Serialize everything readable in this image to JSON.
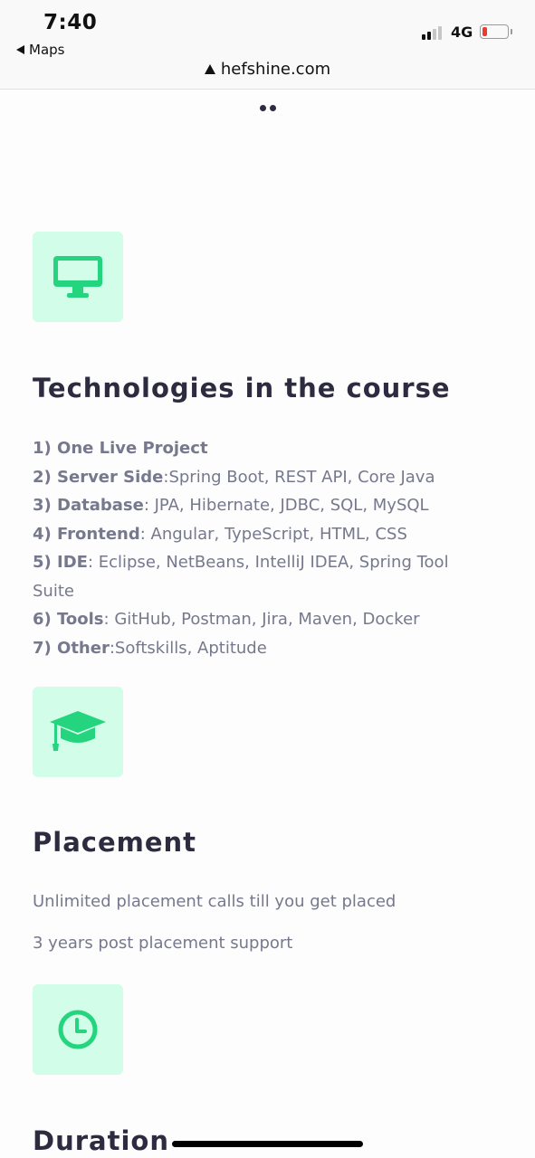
{
  "status_bar": {
    "time": "7:40",
    "back_app": "Maps",
    "network": "4G",
    "url": "hefshine.com"
  },
  "sections": {
    "technologies": {
      "title": "Technologies in the course",
      "icon": "monitor-icon",
      "items": [
        {
          "label": "1) One Live Project",
          "value": ""
        },
        {
          "label": "2) Server Side",
          "value": ":Spring Boot, REST API, Core Java"
        },
        {
          "label": "3) Database",
          "value": ": JPA, Hibernate, JDBC, SQL, MySQL"
        },
        {
          "label": "4) Frontend",
          "value": ": Angular, TypeScript, HTML, CSS"
        },
        {
          "label": "5) IDE",
          "value": ": Eclipse, NetBeans, IntelliJ IDEA, Spring Tool Suite"
        },
        {
          "label": "6) Tools",
          "value": ": GitHub, Postman, Jira, Maven, Docker"
        },
        {
          "label": "7) Other",
          "value": ":Softskills, Aptitude"
        }
      ]
    },
    "placement": {
      "title": "Placement",
      "icon": "graduation-cap-icon",
      "line1": "Unlimited placement calls till you get placed",
      "line2": "3 years post placement support"
    },
    "duration": {
      "title": "Duration",
      "icon": "clock-icon"
    }
  },
  "colors": {
    "accent": "#25d47e",
    "tile_bg": "#d2fde8",
    "heading": "#2c2b3f",
    "body_text": "#76788d"
  }
}
